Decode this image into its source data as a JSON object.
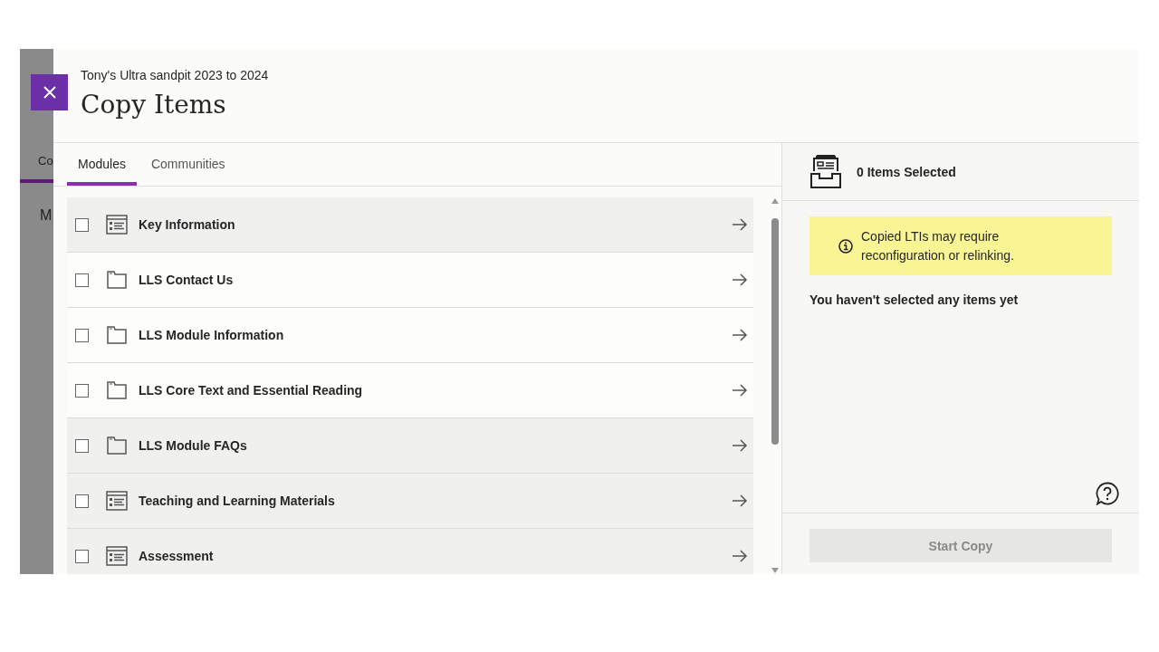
{
  "background_page": {
    "tab": "Co",
    "heading": "M"
  },
  "panel": {
    "subtitle": "Tony's Ultra sandpit 2023 to 2024",
    "title": "Copy Items"
  },
  "tabs": [
    {
      "label": "Modules",
      "selected": true
    },
    {
      "label": "Communities",
      "selected": false
    }
  ],
  "items": [
    {
      "kind": "module",
      "label": "Key Information",
      "checked": false,
      "highlighted": true
    },
    {
      "kind": "folder",
      "label": "LLS Contact Us",
      "checked": false,
      "highlighted": false
    },
    {
      "kind": "folder",
      "label": "LLS Module Information",
      "checked": false,
      "highlighted": false
    },
    {
      "kind": "folder",
      "label": "LLS Core Text and Essential Reading",
      "checked": false,
      "highlighted": false
    },
    {
      "kind": "folder",
      "label": "LLS Module FAQs",
      "checked": false,
      "highlighted": true
    },
    {
      "kind": "module",
      "label": "Teaching and Learning Materials",
      "checked": false,
      "highlighted": true
    },
    {
      "kind": "module",
      "label": "Assessment",
      "checked": false,
      "highlighted": true
    }
  ],
  "selection": {
    "count_label": "0 Items Selected",
    "notice": "Copied LTIs may require reconfiguration or relinking.",
    "empty_message": "You haven't selected any items yet",
    "start_button": {
      "label": "Start Copy",
      "disabled": true
    }
  }
}
